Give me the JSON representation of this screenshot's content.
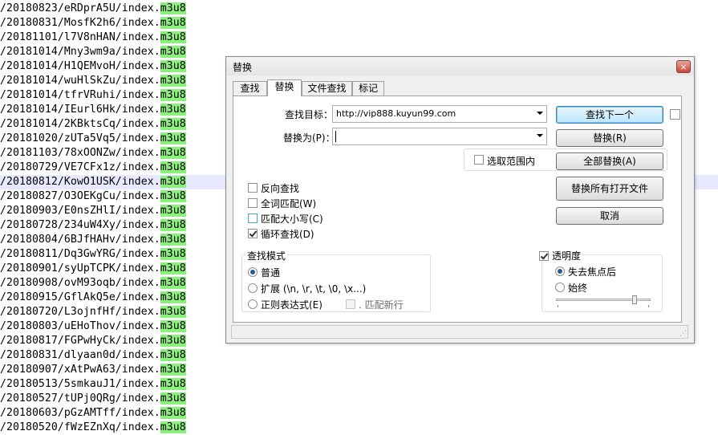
{
  "editor": {
    "lines": [
      {
        "prefix": "/20180823/eRDprA5U/index.",
        "ext": "m3u8"
      },
      {
        "prefix": "/20180831/MosfK2h6/index.",
        "ext": "m3u8"
      },
      {
        "prefix": "/20181101/l7V8nHAN/index.",
        "ext": "m3u8"
      },
      {
        "prefix": "/20181014/Mny3wm9a/index.",
        "ext": "m3u8"
      },
      {
        "prefix": "/20181014/H1QEMvoH/index.",
        "ext": "m3u8"
      },
      {
        "prefix": "/20181014/wuHlSkZu/index.",
        "ext": "m3u8"
      },
      {
        "prefix": "/20181014/tfrVRuhi/index.",
        "ext": "m3u8"
      },
      {
        "prefix": "/20181014/IEurl6Hk/index.",
        "ext": "m3u8"
      },
      {
        "prefix": "/20181014/2KBktsCq/index.",
        "ext": "m3u8"
      },
      {
        "prefix": "/20181020/zUTa5Vq5/index.",
        "ext": "m3u8"
      },
      {
        "prefix": "/20181103/78xOONZw/index.",
        "ext": "m3u8"
      },
      {
        "prefix": "/20180729/VE7CFx1z/index.",
        "ext": "m3u8"
      },
      {
        "prefix": "/20180812/KowO1USK/index.",
        "ext": "m3u8",
        "current": true
      },
      {
        "prefix": "/20180827/O3OEKgCu/index.",
        "ext": "m3u8"
      },
      {
        "prefix": "/20180903/E0nsZHlI/index.",
        "ext": "m3u8"
      },
      {
        "prefix": "/20180728/234uW4Xy/index.",
        "ext": "m3u8"
      },
      {
        "prefix": "/20180804/6BJfHAHv/index.",
        "ext": "m3u8"
      },
      {
        "prefix": "/20180811/Dq3GwYRG/index.",
        "ext": "m3u8"
      },
      {
        "prefix": "/20180901/syUpTCPK/index.",
        "ext": "m3u8"
      },
      {
        "prefix": "/20180908/ovM93oqb/index.",
        "ext": "m3u8"
      },
      {
        "prefix": "/20180915/GflAkQ5e/index.",
        "ext": "m3u8"
      },
      {
        "prefix": "/20180720/L3ojnfHf/index.",
        "ext": "m3u8"
      },
      {
        "prefix": "/20180803/uEHoThov/index.",
        "ext": "m3u8"
      },
      {
        "prefix": "/20180817/FGPwHyCk/index.",
        "ext": "m3u8"
      },
      {
        "prefix": "/20180831/dlyaan0d/index.",
        "ext": "m3u8"
      },
      {
        "prefix": "/20180907/xAtPwA63/index.",
        "ext": "m3u8"
      },
      {
        "prefix": "/20180513/5smkauJ1/index.",
        "ext": "m3u8"
      },
      {
        "prefix": "/20180527/tUPj0QRg/index.",
        "ext": "m3u8"
      },
      {
        "prefix": "/20180603/pGzAMTff/index.",
        "ext": "m3u8"
      },
      {
        "prefix": "/20180520/fWzEZnXq/index.",
        "ext": "m3u8"
      }
    ],
    "highlight_color": "#8cf07d"
  },
  "dialog": {
    "title": "替换",
    "close_symbol": "×",
    "tabs": [
      {
        "label": "查找",
        "active": false
      },
      {
        "label": "替换",
        "active": true
      },
      {
        "label": "文件查找",
        "active": false
      },
      {
        "label": "标记",
        "active": false
      }
    ],
    "find_label": "查找目标：",
    "find_value": "http://vip888.kuyun99.com",
    "replace_label": "替换为(P)：",
    "replace_value": "",
    "buttons": {
      "find_next": "查找下一个",
      "replace": "替换(R)",
      "replace_all": "全部替换(A)",
      "replace_all_open": "替换所有打开文件",
      "cancel": "取消"
    },
    "in_selection": "选取范围内",
    "options": {
      "backward": "反向查找",
      "whole_word": "全词匹配(W)",
      "match_case": "匹配大小写(C)",
      "wrap": "循环查找(D)"
    },
    "search_mode": {
      "title": "查找模式",
      "normal": "普通",
      "extended": "扩展 (\\n, \\r, \\t, \\0, \\x...)",
      "regex": "正则表达式(E)",
      "dot_newline": ". 匹配新行"
    },
    "transparency": {
      "title": "透明度",
      "on_lose_focus": "失去焦点后",
      "always": "始终",
      "level": 0.85
    }
  }
}
